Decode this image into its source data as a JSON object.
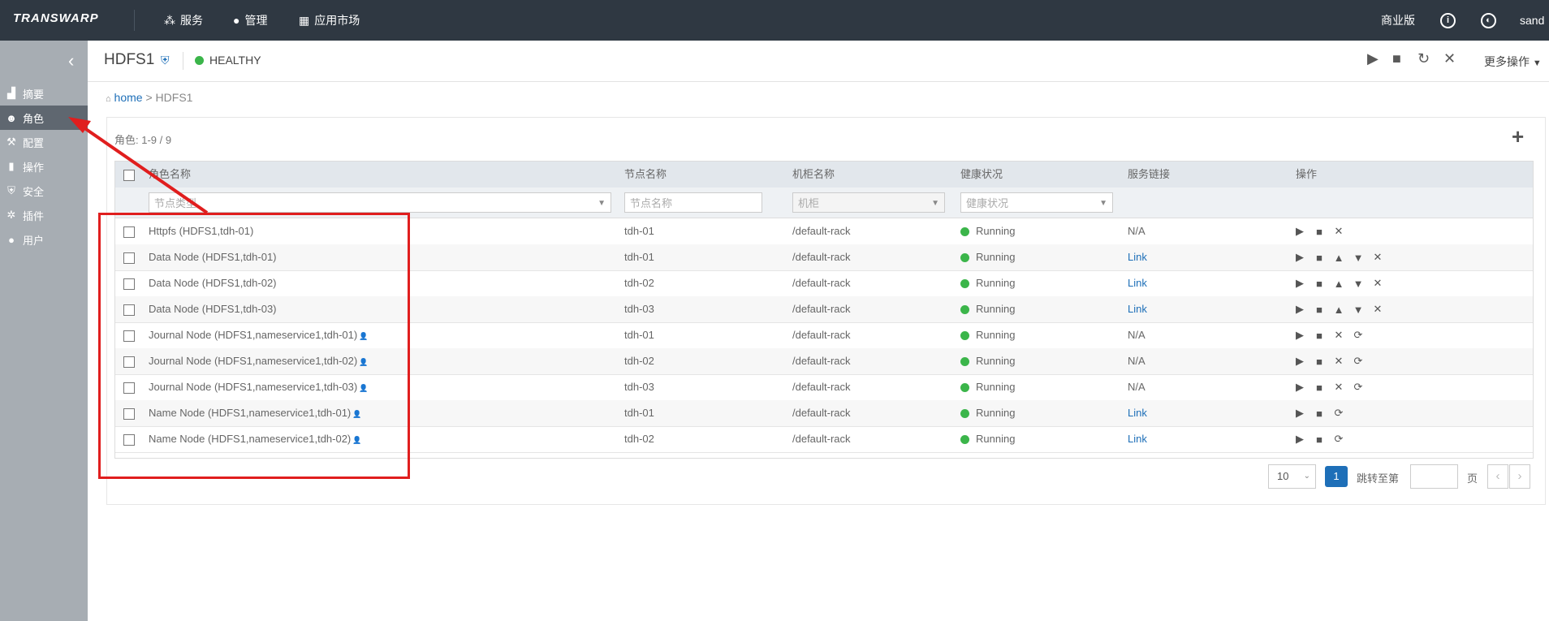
{
  "topbar": {
    "logo": "TRANSWARP",
    "nav": [
      {
        "label": "服务",
        "icon": "services-icon"
      },
      {
        "label": "管理",
        "icon": "user-icon"
      },
      {
        "label": "应用市场",
        "icon": "apps-icon"
      }
    ],
    "edition": "商业版",
    "user": "sand"
  },
  "sidebar": {
    "items": [
      {
        "label": "摘要",
        "icon": "chart-icon"
      },
      {
        "label": "角色",
        "icon": "mask-icon"
      },
      {
        "label": "配置",
        "icon": "tools-icon"
      },
      {
        "label": "操作",
        "icon": "tool-icon"
      },
      {
        "label": "安全",
        "icon": "shield-icon"
      },
      {
        "label": "插件",
        "icon": "plugin-icon"
      },
      {
        "label": "用户",
        "icon": "user-icon"
      }
    ],
    "active_index": 1
  },
  "service": {
    "name": "HDFS1",
    "health": "HEALTHY",
    "more_actions": "更多操作"
  },
  "breadcrumb": {
    "home": "home",
    "sep": " > ",
    "current": "HDFS1"
  },
  "roles": {
    "count_label": "角色:",
    "count_value": "1-9 / 9",
    "columns": [
      "角色名称",
      "节点名称",
      "机柜名称",
      "健康状况",
      "服务链接",
      "操作"
    ],
    "filters": {
      "role_type_placeholder": "节点类型",
      "node_placeholder": "节点名称",
      "rack_placeholder": "机柜",
      "health_placeholder": "健康状况"
    },
    "rows": [
      {
        "name": "Httpfs (HDFS1,tdh-01)",
        "node": "tdh-01",
        "rack": "/default-rack",
        "status": "Running",
        "link": "N/A",
        "user_icon": false
      },
      {
        "name": "Data Node (HDFS1,tdh-01)",
        "node": "tdh-01",
        "rack": "/default-rack",
        "status": "Running",
        "link": "Link",
        "user_icon": false
      },
      {
        "name": "Data Node (HDFS1,tdh-02)",
        "node": "tdh-02",
        "rack": "/default-rack",
        "status": "Running",
        "link": "Link",
        "user_icon": false
      },
      {
        "name": "Data Node (HDFS1,tdh-03)",
        "node": "tdh-03",
        "rack": "/default-rack",
        "status": "Running",
        "link": "Link",
        "user_icon": false
      },
      {
        "name": "Journal Node (HDFS1,nameservice1,tdh-01)",
        "node": "tdh-01",
        "rack": "/default-rack",
        "status": "Running",
        "link": "N/A",
        "user_icon": true
      },
      {
        "name": "Journal Node (HDFS1,nameservice1,tdh-02)",
        "node": "tdh-02",
        "rack": "/default-rack",
        "status": "Running",
        "link": "N/A",
        "user_icon": true
      },
      {
        "name": "Journal Node (HDFS1,nameservice1,tdh-03)",
        "node": "tdh-03",
        "rack": "/default-rack",
        "status": "Running",
        "link": "N/A",
        "user_icon": true
      },
      {
        "name": "Name Node (HDFS1,nameservice1,tdh-01)",
        "node": "tdh-01",
        "rack": "/default-rack",
        "status": "Running",
        "link": "Link",
        "user_icon": true
      },
      {
        "name": "Name Node (HDFS1,nameservice1,tdh-02)",
        "node": "tdh-02",
        "rack": "/default-rack",
        "status": "Running",
        "link": "Link",
        "user_icon": true
      }
    ],
    "row_ops": [
      [
        "play-icon",
        "stop-icon",
        "close-icon"
      ],
      [
        "play-icon",
        "stop-icon",
        "up-icon",
        "down-icon",
        "close-icon"
      ],
      [
        "play-icon",
        "stop-icon",
        "up-icon",
        "down-icon",
        "close-icon"
      ],
      [
        "play-icon",
        "stop-icon",
        "up-icon",
        "down-icon",
        "close-icon"
      ],
      [
        "play-icon",
        "stop-icon",
        "close-icon",
        "refresh-icon"
      ],
      [
        "play-icon",
        "stop-icon",
        "close-icon",
        "refresh-icon"
      ],
      [
        "play-icon",
        "stop-icon",
        "close-icon",
        "refresh-icon"
      ],
      [
        "play-icon",
        "stop-icon",
        "refresh-icon"
      ],
      [
        "play-icon",
        "stop-icon",
        "refresh-icon"
      ]
    ]
  },
  "pagination": {
    "page_size": "10",
    "current_page": "1",
    "jump_label": "跳转至第",
    "page_label": "页"
  },
  "colors": {
    "topbar": "#2f3842",
    "sidebar": "#a7adb3",
    "accent": "#1e6fb8",
    "healthy": "#3bb54a",
    "annotation": "#e01e1e"
  }
}
